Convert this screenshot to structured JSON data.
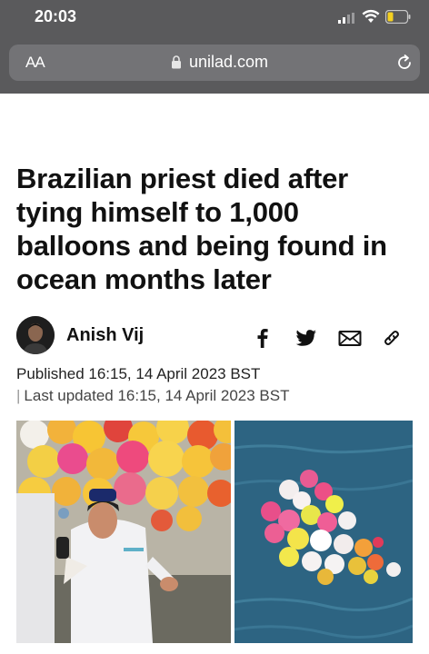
{
  "status": {
    "time": "20:03"
  },
  "browser": {
    "text_size_label": "AA",
    "url": "unilad.com"
  },
  "article": {
    "headline": "Brazilian priest died after tying himself to 1,000 balloons and being found in ocean months later",
    "author": "Anish Vij",
    "published": "Published 16:15, 14 April 2023 BST",
    "updated": "Last updated 16:15, 14 April 2023 BST"
  },
  "share_icons": [
    "facebook-icon",
    "twitter-icon",
    "email-icon",
    "link-icon"
  ]
}
